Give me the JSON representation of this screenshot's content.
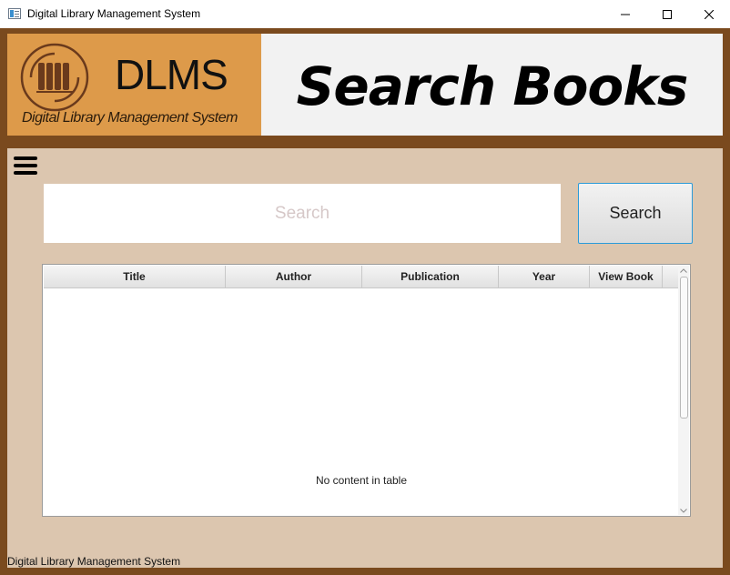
{
  "window": {
    "title": "Digital Library Management System",
    "controls": [
      "minimize-icon",
      "maximize-icon",
      "close-icon"
    ]
  },
  "banner": {
    "logo_text": "DLMS",
    "logo_subtitle": "Digital Library Management System",
    "page_title": "Search Books"
  },
  "colors": {
    "frame": "#7a4a1e",
    "logo_background": "#dd9a4a",
    "content_background": "#dcc6af",
    "button_border_accent": "#2b9bd9"
  },
  "search": {
    "placeholder": "Search",
    "value": "",
    "button_label": "Search"
  },
  "table": {
    "columns": [
      "Title",
      "Author",
      "Publication",
      "Year",
      "View Book"
    ],
    "rows": [],
    "empty_message": "No content in table"
  },
  "status_bar": {
    "text": "Digital Library Management System"
  }
}
